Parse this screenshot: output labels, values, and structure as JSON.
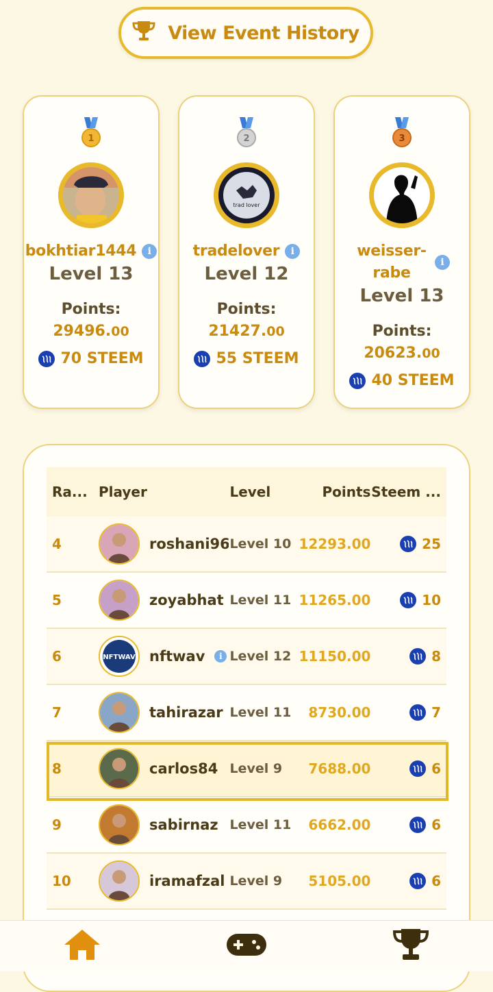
{
  "header": {
    "history_button": "View Event History"
  },
  "podium": [
    {
      "medal_number": "1",
      "username": "bokhtiar1444",
      "level": "Level 13",
      "points_label": "Points:",
      "points_int": "29496.",
      "points_dec": "00",
      "reward": "70 STEEM",
      "medal_color": "#f2b632"
    },
    {
      "medal_number": "2",
      "username": "tradelover",
      "level": "Level 12",
      "points_label": "Points:",
      "points_int": "21427.",
      "points_dec": "00",
      "reward": "55 STEEM",
      "medal_color": "#c9c9c9"
    },
    {
      "medal_number": "3",
      "username": "weisser-rabe",
      "level": "Level 13",
      "points_label": "Points:",
      "points_int": "20623.",
      "points_dec": "00",
      "reward": "40 STEEM",
      "medal_color": "#e88a3a"
    }
  ],
  "table": {
    "headers": {
      "rank": "Ra...",
      "player": "Player",
      "level": "Level",
      "points": "Points",
      "steem": "Steem ..."
    },
    "rows": [
      {
        "rank": "4",
        "player": "roshani96",
        "level": "Level 10",
        "points": "12293.00",
        "steem": "25"
      },
      {
        "rank": "5",
        "player": "zoyabhat",
        "level": "Level 11",
        "points": "11265.00",
        "steem": "10"
      },
      {
        "rank": "6",
        "player": "nftwav",
        "level": "Level 12",
        "points": "11150.00",
        "steem": "8"
      },
      {
        "rank": "7",
        "player": "tahirazar",
        "level": "Level 11",
        "points": "8730.00",
        "steem": "7"
      },
      {
        "rank": "8",
        "player": "carlos84",
        "level": "Level 9",
        "points": "7688.00",
        "steem": "6"
      },
      {
        "rank": "9",
        "player": "sabirnaz",
        "level": "Level 11",
        "points": "6662.00",
        "steem": "6"
      },
      {
        "rank": "10",
        "player": "iramafzal",
        "level": "Level 9",
        "points": "5105.00",
        "steem": "6"
      }
    ]
  },
  "nav": {
    "home": "home-icon",
    "games": "gamepad-icon",
    "leaderboard": "trophy-icon"
  },
  "colors": {
    "accent": "#e8b92b",
    "gold_text": "#c98a10",
    "steem_blue": "#1a3fb0"
  }
}
